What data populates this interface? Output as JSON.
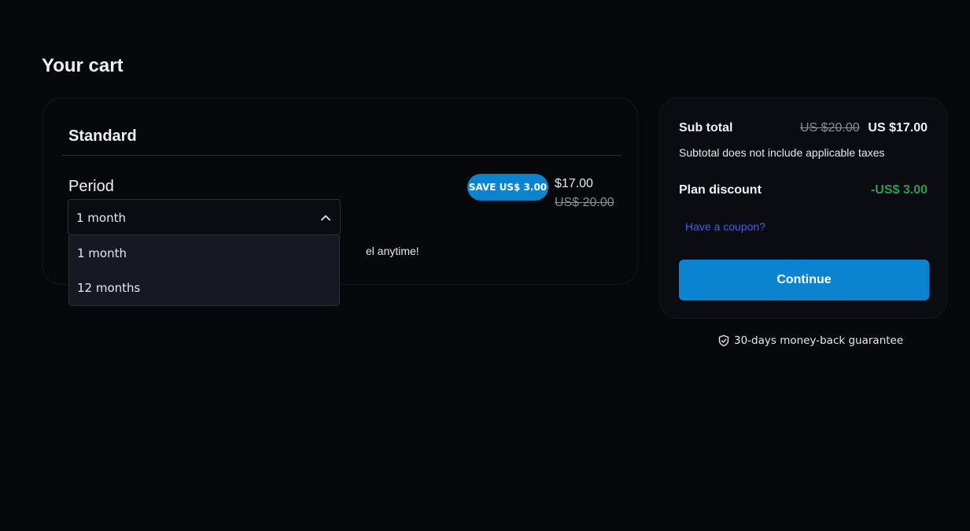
{
  "page": {
    "title": "Your cart"
  },
  "plan": {
    "name": "Standard",
    "period_label": "Period",
    "save_badge": "SAVE US$ 3.00",
    "price_current": "$17.00",
    "price_original": "US$ 20.00",
    "cancel_note_visible": "el anytime!",
    "period_select": {
      "selected": "1 month",
      "options": [
        "1 month",
        "12 months"
      ],
      "expanded": true
    }
  },
  "summary": {
    "subtotal_label": "Sub total",
    "subtotal_original": "US $20.00",
    "subtotal_current": "US $17.00",
    "tax_note": "Subtotal does not include applicable taxes",
    "discount_label": "Plan discount",
    "discount_value": "-US$ 3.00",
    "coupon_link": "Have a coupon?",
    "continue_label": "Continue",
    "guarantee": "30-days money-back guarantee"
  },
  "colors": {
    "background": "#07080c",
    "accent": "#0a84cf",
    "discount_green": "#2f9a57",
    "link_blue": "#3b63e8"
  },
  "icons": {
    "select_toggle": "chevron-up-icon",
    "guarantee": "shield-check-icon"
  }
}
